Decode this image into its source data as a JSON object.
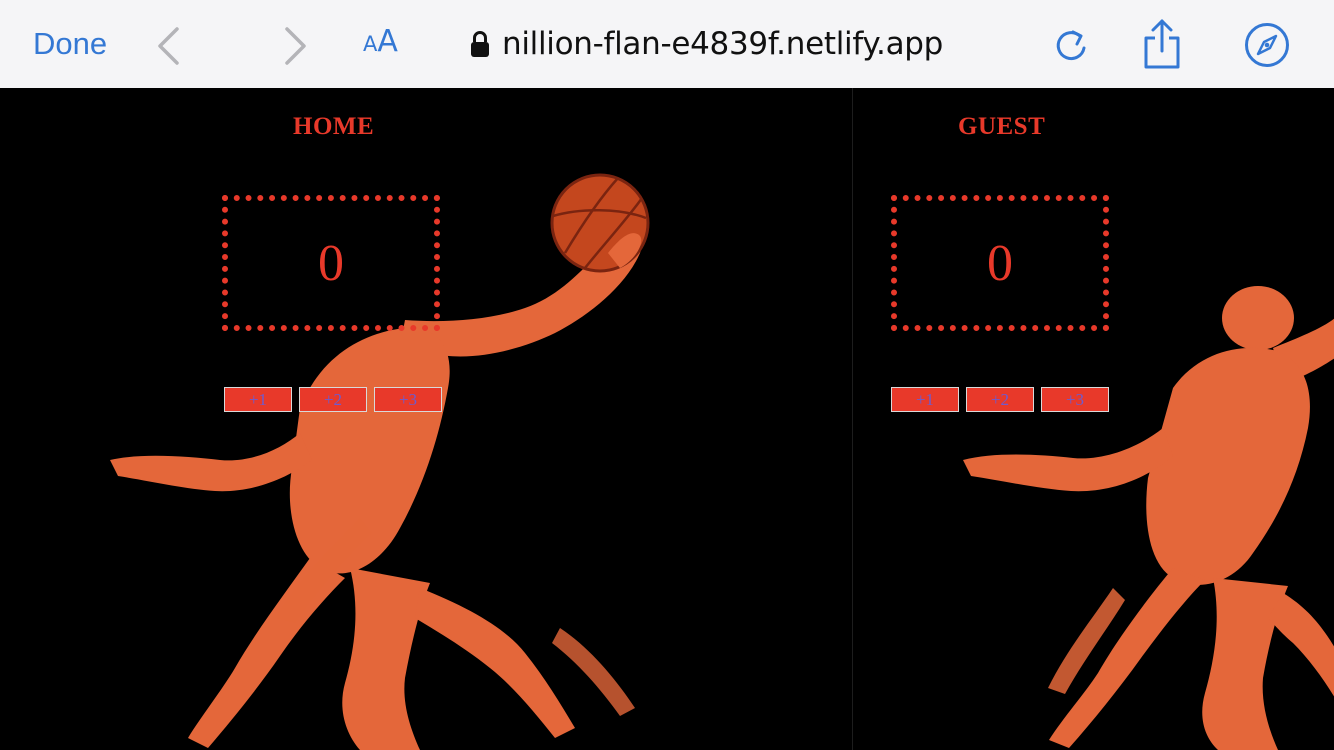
{
  "browser": {
    "done_label": "Done",
    "text_size_small": "A",
    "text_size_large": "A",
    "url": "nillion-flan-e4839f.netlify.app",
    "accent_color": "#3478d4"
  },
  "home": {
    "title": "HOME",
    "score": "0",
    "buttons": [
      "+1",
      "+2",
      "+3"
    ]
  },
  "guest": {
    "title": "GUEST",
    "score": "0",
    "buttons": [
      "+1",
      "+2",
      "+3"
    ]
  },
  "colors": {
    "background": "#000000",
    "score_red": "#e8392a",
    "player_orange": "#e4673a",
    "button_text": "#6d5bd0"
  }
}
